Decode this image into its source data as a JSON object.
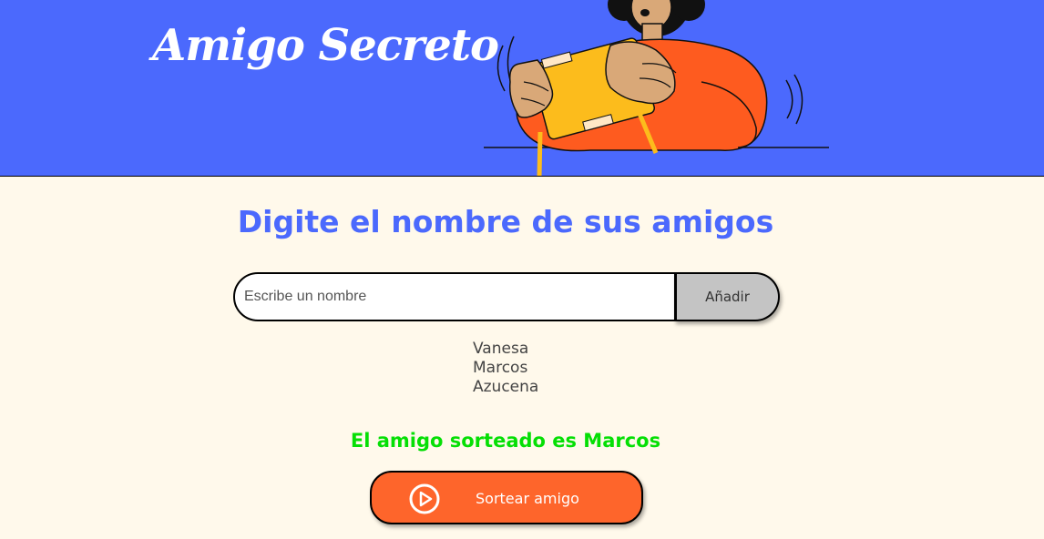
{
  "header": {
    "title": "Amigo Secreto",
    "illustration_icon": "person-holding-box-illustration"
  },
  "main": {
    "heading": "Digite el nombre de sus amigos",
    "input": {
      "placeholder": "Escribe un nombre",
      "value": ""
    },
    "add_button_label": "Añadir",
    "friends": [
      "Vanesa",
      "Marcos",
      "Azucena"
    ],
    "result_text": "El amigo sorteado es Marcos",
    "draw_button_label": "Sortear amigo",
    "draw_button_icon": "play-circle-icon"
  },
  "colors": {
    "header_bg": "#4B69FD",
    "page_bg": "#FFF9EB",
    "accent_orange": "#FE652B",
    "result_green": "#05DF05",
    "add_button_gray": "#C4C4C4"
  }
}
